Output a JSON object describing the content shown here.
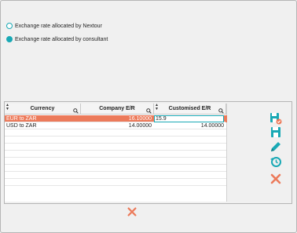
{
  "options": {
    "nextour_label": "Exchange rate allocated by Nextour",
    "consultant_label": "Exchange rate allocated by consultant",
    "selected": "consultant"
  },
  "grid": {
    "columns": [
      "Currency",
      "Company E/R",
      "Customised E/R"
    ],
    "rows": [
      {
        "currency": "EUR to ZAR",
        "company": "16.10000",
        "customised": "15.9"
      },
      {
        "currency": "USD to ZAR",
        "company": "14.00000",
        "customised": "14.00000"
      }
    ]
  },
  "colors": {
    "accent": "#19a9b5",
    "selection": "#ec7a5a",
    "cancel": "#ec7a5a"
  },
  "icons": [
    "save-check-icon",
    "save-icon",
    "edit-pencil-icon",
    "history-clock-icon",
    "cancel-x-icon"
  ]
}
